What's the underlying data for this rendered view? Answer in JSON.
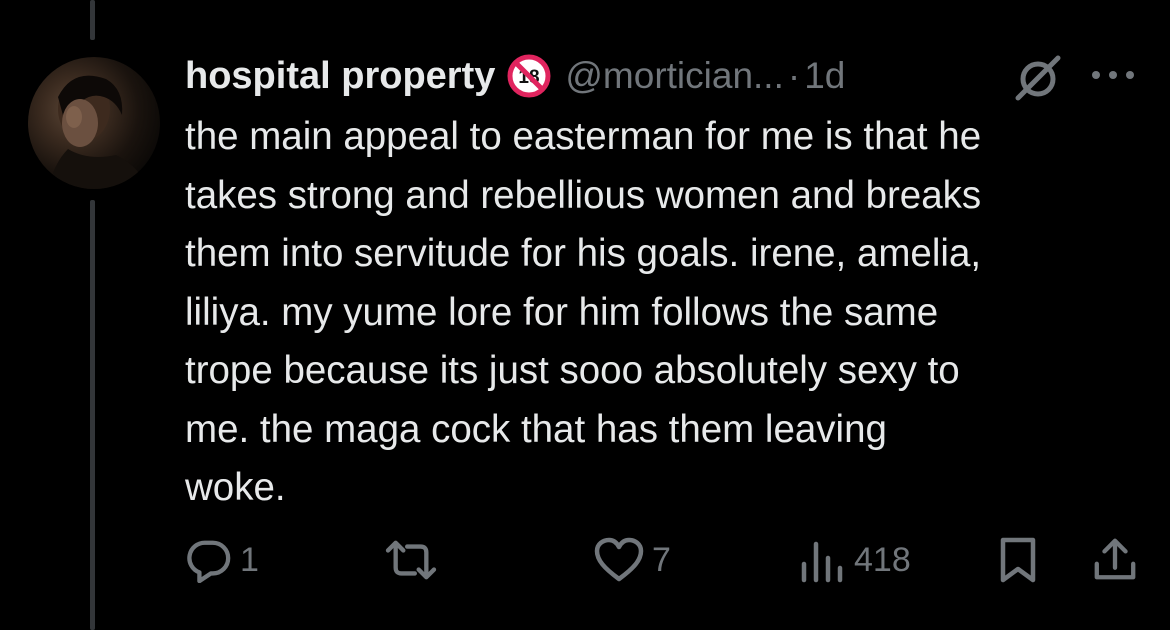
{
  "tweet": {
    "author": {
      "display_name": "hospital property",
      "handle": "@mortician...",
      "badge_icon": "no-under-18-icon"
    },
    "separator": "·",
    "time": "1d",
    "text_lines": [
      "the main appeal to easterman for me is that he",
      "takes strong and rebellious women and breaks",
      "them into servitude for his goals. irene, amelia,",
      "liliya. my yume lore for him follows the same",
      "trope because its just sooo absolutely sexy to",
      "me. the maga cock that has them leaving",
      "woke."
    ],
    "actions": {
      "reply": {
        "icon": "reply-icon",
        "count": "1"
      },
      "repost": {
        "icon": "repost-icon",
        "count": ""
      },
      "like": {
        "icon": "heart-icon",
        "count": "7"
      },
      "views": {
        "icon": "views-icon",
        "count": "418"
      },
      "bookmark": {
        "icon": "bookmark-icon"
      },
      "share": {
        "icon": "share-icon"
      }
    }
  },
  "colors": {
    "background": "#000000",
    "text_primary": "#e7e9ea",
    "text_secondary": "#71767b",
    "thread_line": "#333639",
    "badge_red": "#e0245e"
  }
}
